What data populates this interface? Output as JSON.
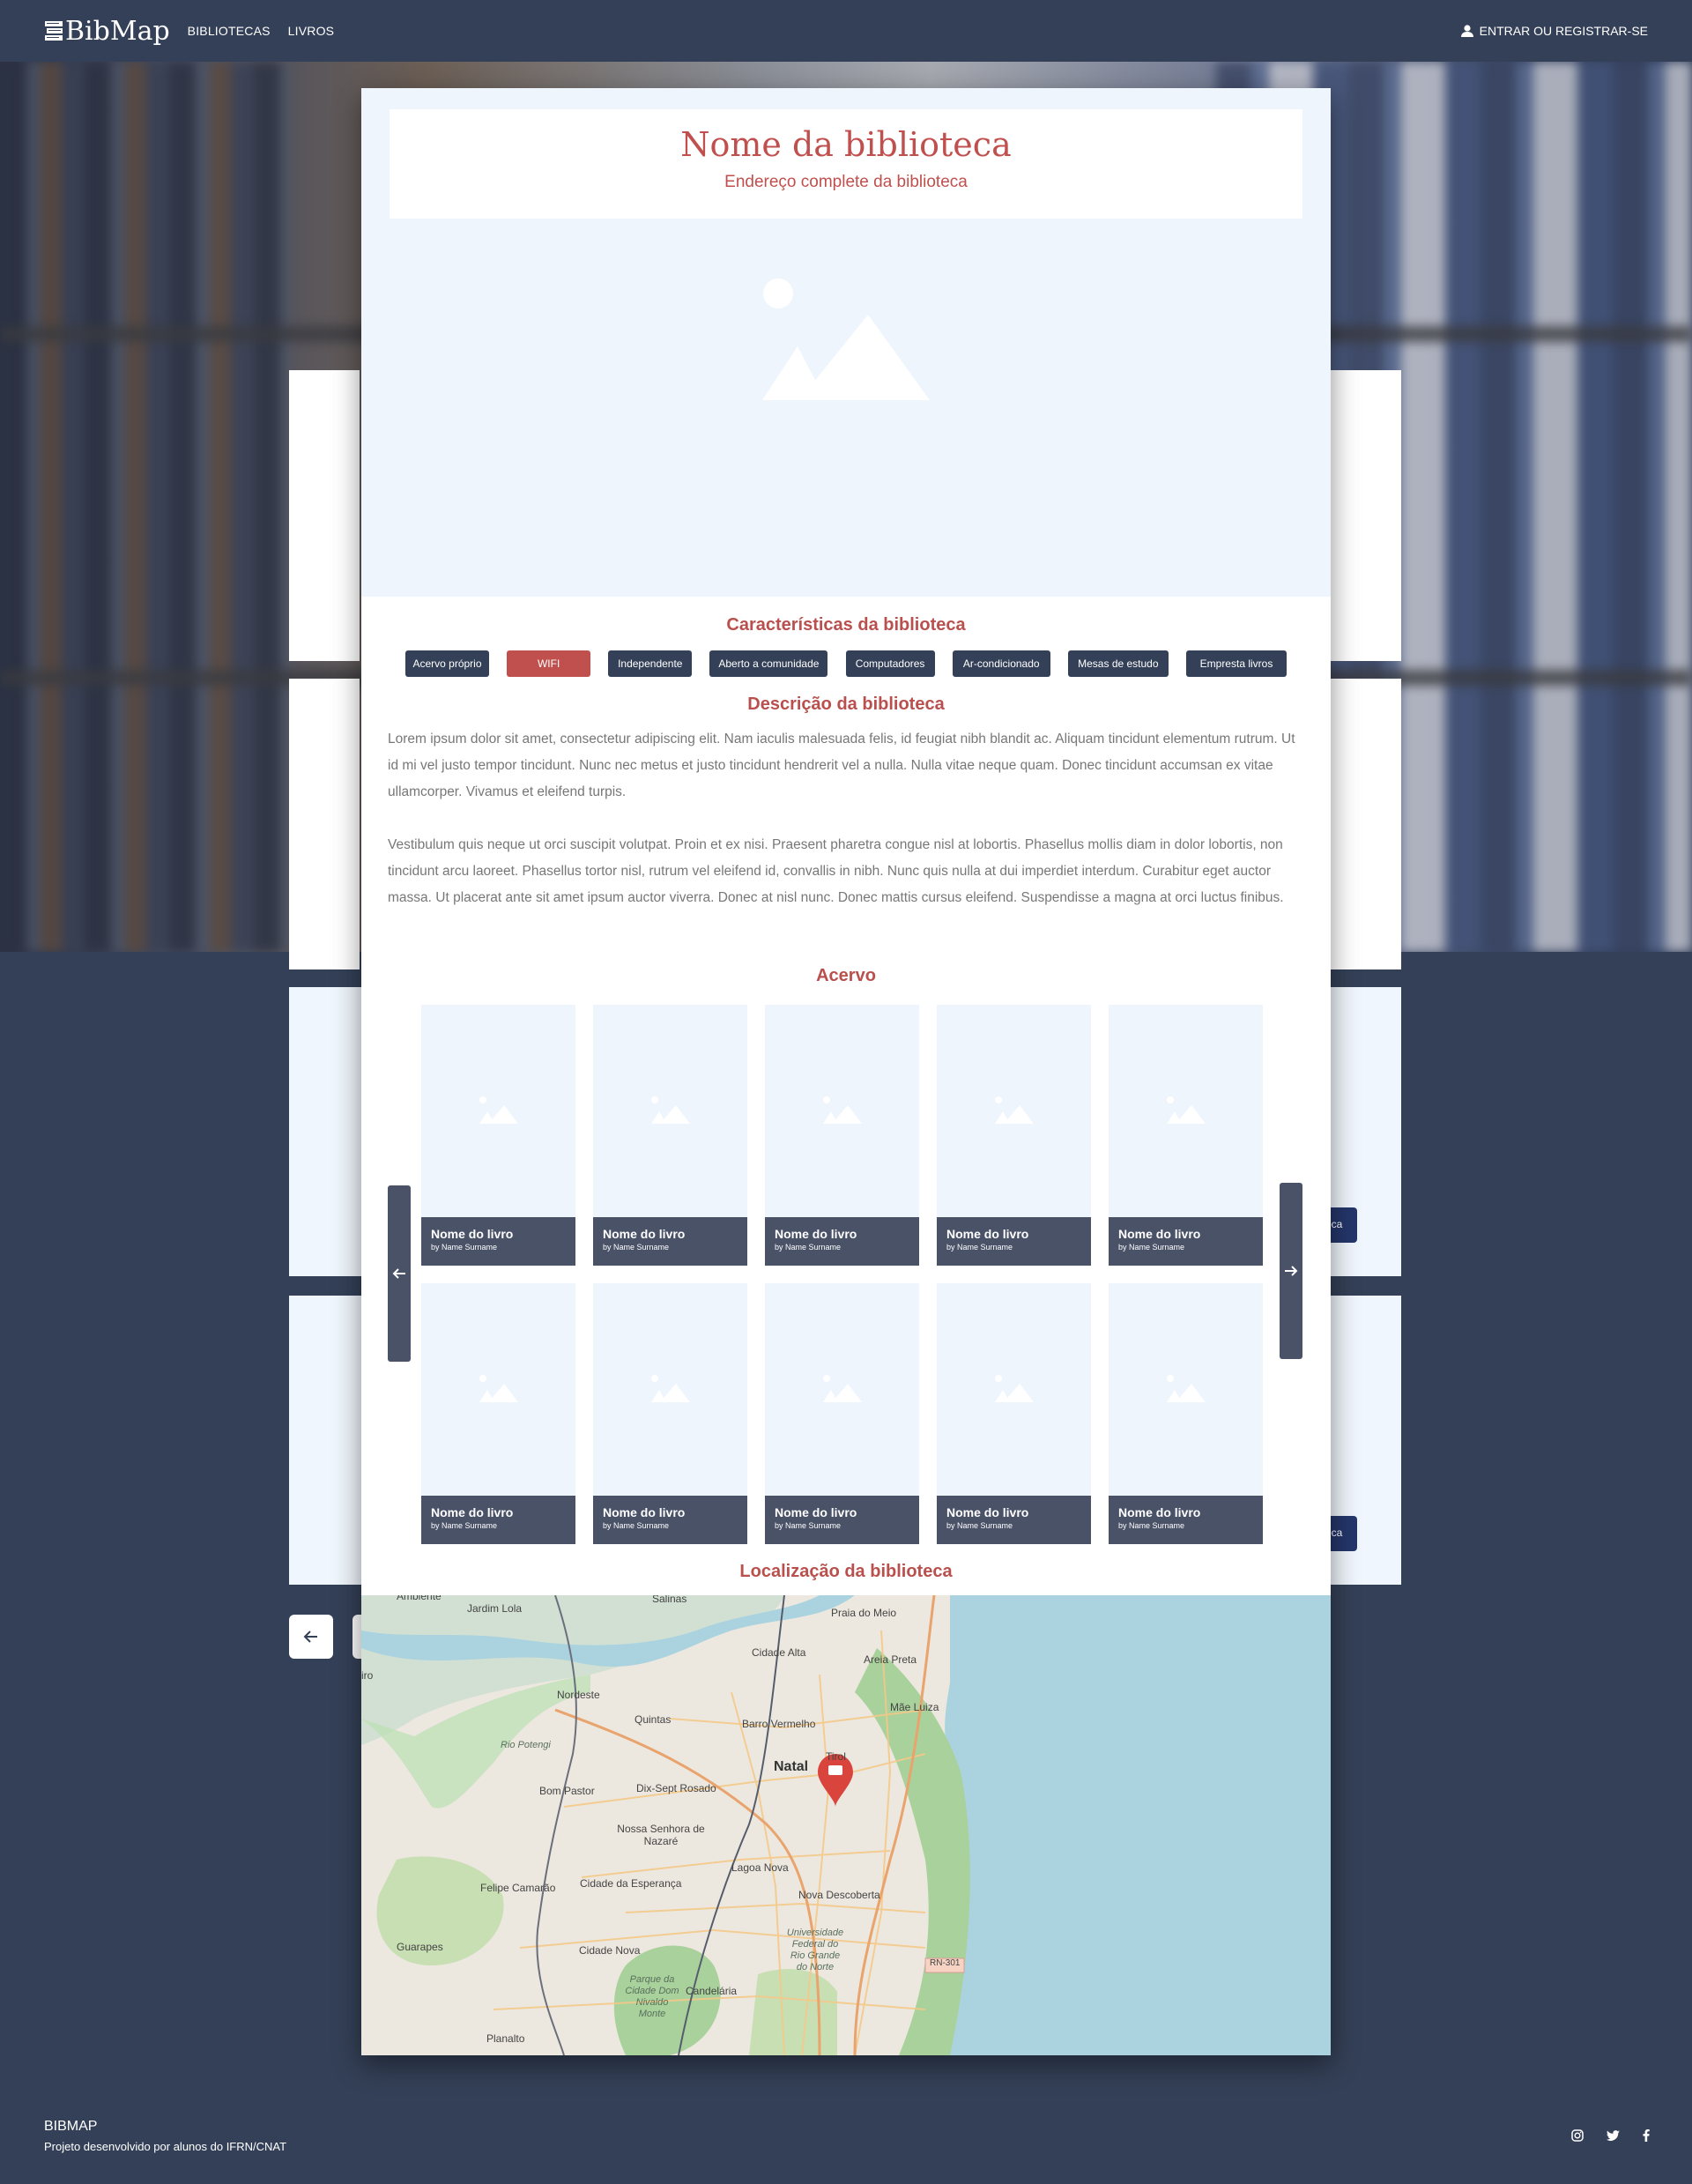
{
  "header": {
    "brand": "BibMap",
    "nav": [
      "BIBLIOTECAS",
      "LIVROS"
    ],
    "login": "ENTRAR OU REGISTRAR-SE"
  },
  "background": {
    "button_label": "eca"
  },
  "modal": {
    "name": "Nome da biblioteca",
    "address": "Endereço complete da biblioteca",
    "features_title": "Características da biblioteca",
    "features": [
      {
        "label": "Acervo próprio",
        "active": false
      },
      {
        "label": "WIFI",
        "active": true
      },
      {
        "label": "Independente",
        "active": false
      },
      {
        "label": "Aberto a comunidade",
        "active": false
      },
      {
        "label": "Computadores",
        "active": false
      },
      {
        "label": "Ar-condicionado",
        "active": false
      },
      {
        "label": "Mesas de estudo",
        "active": false
      },
      {
        "label": "Empresta livros",
        "active": false
      }
    ],
    "description_title": "Descrição da biblioteca",
    "description": [
      "Lorem ipsum dolor sit amet, consectetur adipiscing elit. Nam iaculis malesuada felis, id feugiat nibh blandit ac. Aliquam tincidunt elementum rutrum. Ut id mi vel justo tempor tincidunt. Nunc nec metus et justo tincidunt hendrerit vel a nulla. Nulla vitae neque quam. Donec tincidunt accumsan ex vitae ullamcorper. Vivamus et eleifend turpis.",
      "Vestibulum quis neque ut orci suscipit volutpat. Proin et ex nisi. Praesent pharetra congue nisl at lobortis. Phasellus mollis diam in dolor lobortis, non tincidunt arcu laoreet. Phasellus tortor nisl, rutrum vel eleifend id, convallis in nibh. Nunc quis nulla at dui imperdiet interdum. Curabitur eget auctor massa. Ut placerat ante sit amet ipsum auctor viverra. Donec at nisl nunc. Donec mattis cursus eleifend. Suspendisse a magna at orci luctus finibus."
    ],
    "collection_title": "Acervo",
    "books": [
      {
        "title": "Nome do livro",
        "author": "by Name Surname"
      },
      {
        "title": "Nome do livro",
        "author": "by Name Surname"
      },
      {
        "title": "Nome do livro",
        "author": "by Name Surname"
      },
      {
        "title": "Nome do livro",
        "author": "by Name Surname"
      },
      {
        "title": "Nome do livro",
        "author": "by Name Surname"
      },
      {
        "title": "Nome do livro",
        "author": "by Name Surname"
      },
      {
        "title": "Nome do livro",
        "author": "by Name Surname"
      },
      {
        "title": "Nome do livro",
        "author": "by Name Surname"
      },
      {
        "title": "Nome do livro",
        "author": "by Name Surname"
      },
      {
        "title": "Nome do livro",
        "author": "by Name Surname"
      }
    ],
    "location_title": "Localização da biblioteca",
    "map_labels": [
      "Jardim Lola",
      "Salinas",
      "Praia do Meio",
      "Cidade Alta",
      "Areia Preta",
      "Nordeste",
      "Quintas",
      "Mãe Luiza",
      "Barro Vermelho",
      "Rio Potengi",
      "Tirol",
      "Natal",
      "Bom Pastor",
      "Dix-Sept Rosado",
      "Nossa Senhora de Nazaré",
      "Lagoa Nova",
      "Felipe Camarão",
      "Cidade da Esperança",
      "Nova Descoberta",
      "Universidade Federal do Rio Grande do Norte",
      "RN-301",
      "Guarapes",
      "Cidade Nova",
      "Parque da Cidade Dom Nivaldo Monte",
      "Candelária",
      "Planalto",
      "Ambiente",
      "iro"
    ]
  },
  "footer": {
    "title": "BIBMAP",
    "subtitle": "Projeto desenvolvido por alunos do IFRN/CNAT",
    "socials": [
      "instagram-icon",
      "twitter-icon",
      "facebook-icon"
    ]
  }
}
